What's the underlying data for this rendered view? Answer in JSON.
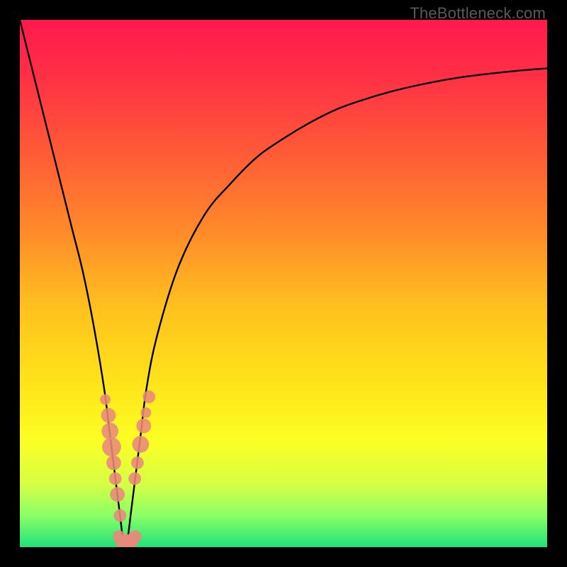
{
  "watermark": "TheBottleneck.com",
  "colors": {
    "frame": "#000000",
    "gradient_stops": [
      {
        "offset": 0.0,
        "color": "#ff1a4d"
      },
      {
        "offset": 0.1,
        "color": "#ff2e46"
      },
      {
        "offset": 0.25,
        "color": "#ff5a37"
      },
      {
        "offset": 0.4,
        "color": "#ff8a2a"
      },
      {
        "offset": 0.55,
        "color": "#ffc21e"
      },
      {
        "offset": 0.7,
        "color": "#ffe61a"
      },
      {
        "offset": 0.8,
        "color": "#fbff24"
      },
      {
        "offset": 0.88,
        "color": "#d6ff44"
      },
      {
        "offset": 0.94,
        "color": "#8bff66"
      },
      {
        "offset": 1.0,
        "color": "#22e07a"
      }
    ],
    "curve": "#000000",
    "bead": "#e8897b"
  },
  "chart_data": {
    "type": "line",
    "title": "",
    "xlabel": "",
    "ylabel": "",
    "xlim": [
      0,
      100
    ],
    "ylim": [
      0,
      100
    ],
    "grid": false,
    "legend": false,
    "series": [
      {
        "name": "bottleneck-curve",
        "x": [
          0,
          2,
          4,
          6,
          8,
          10,
          12,
          14,
          16,
          17,
          18,
          19,
          19.5,
          20,
          20.5,
          21,
          22,
          23,
          24,
          26,
          30,
          35,
          40,
          45,
          50,
          55,
          60,
          65,
          70,
          75,
          80,
          85,
          90,
          95,
          100
        ],
        "y": [
          100,
          92,
          84,
          76,
          68,
          60,
          52,
          42,
          30,
          22,
          14,
          6,
          2,
          0,
          2,
          6,
          14,
          22,
          30,
          40,
          53,
          63,
          69,
          74,
          77.5,
          80.5,
          83,
          84.8,
          86.3,
          87.5,
          88.5,
          89.3,
          89.9,
          90.4,
          90.8
        ],
        "note": "x is percent along horizontal axis (0=left, 100=right); y is percent of vertical axis (0=bottom/green, 100=top/red). Values estimated from pixels."
      }
    ],
    "marker_clusters": [
      {
        "name": "left-branch-beads",
        "points": [
          {
            "x": 16.2,
            "y": 28.0,
            "r": 1.0
          },
          {
            "x": 16.8,
            "y": 25.0,
            "r": 1.4
          },
          {
            "x": 17.1,
            "y": 22.0,
            "r": 1.6
          },
          {
            "x": 17.4,
            "y": 19.0,
            "r": 1.8
          },
          {
            "x": 17.8,
            "y": 16.0,
            "r": 1.4
          },
          {
            "x": 18.1,
            "y": 13.0,
            "r": 1.2
          },
          {
            "x": 18.5,
            "y": 10.0,
            "r": 1.4
          },
          {
            "x": 19.0,
            "y": 6.0,
            "r": 1.2
          }
        ]
      },
      {
        "name": "right-branch-beads",
        "points": [
          {
            "x": 21.8,
            "y": 13.0,
            "r": 1.2
          },
          {
            "x": 22.3,
            "y": 16.0,
            "r": 1.2
          },
          {
            "x": 22.9,
            "y": 19.5,
            "r": 1.6
          },
          {
            "x": 23.5,
            "y": 23.0,
            "r": 1.4
          },
          {
            "x": 23.9,
            "y": 25.5,
            "r": 1.0
          },
          {
            "x": 24.5,
            "y": 28.5,
            "r": 1.2
          }
        ]
      },
      {
        "name": "trough-beads",
        "points": [
          {
            "x": 18.8,
            "y": 2.0,
            "r": 1.2
          },
          {
            "x": 19.5,
            "y": 1.0,
            "r": 1.4
          },
          {
            "x": 20.3,
            "y": 1.0,
            "r": 1.4
          },
          {
            "x": 21.1,
            "y": 1.2,
            "r": 1.4
          },
          {
            "x": 21.9,
            "y": 2.0,
            "r": 1.2
          }
        ]
      }
    ]
  }
}
